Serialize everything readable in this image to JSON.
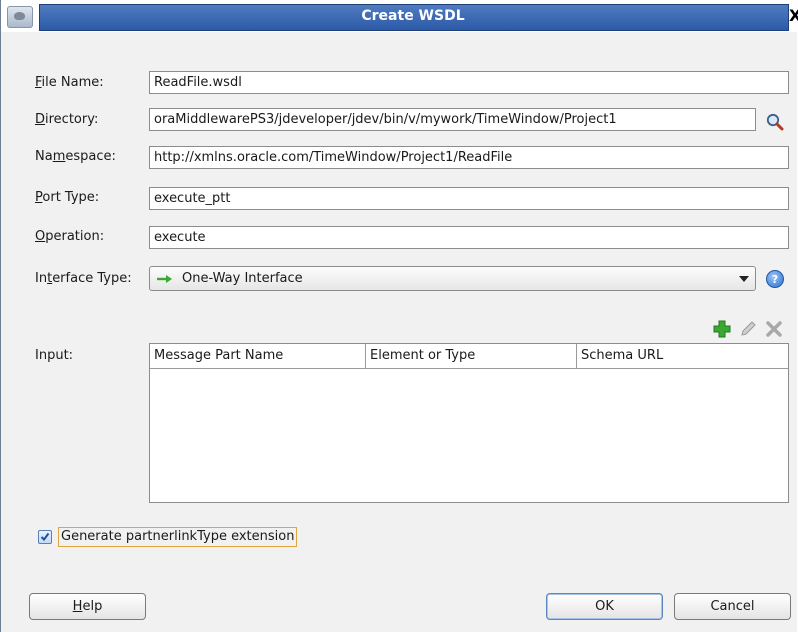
{
  "window": {
    "title": "Create WSDL",
    "close_glyph": "X"
  },
  "form": {
    "file_name": {
      "label_pre": "",
      "label_ul": "F",
      "label_post": "ile Name:",
      "value": "ReadFile.wsdl"
    },
    "directory": {
      "label_pre": "",
      "label_ul": "D",
      "label_post": "irectory:",
      "value": "oraMiddlewarePS3/jdeveloper/jdev/bin/v/mywork/TimeWindow/Project1"
    },
    "namespace": {
      "label_pre": "Na",
      "label_ul": "m",
      "label_post": "espace:",
      "value": "http://xmlns.oracle.com/TimeWindow/Project1/ReadFile"
    },
    "port_type": {
      "label_pre": "",
      "label_ul": "P",
      "label_post": "ort Type:",
      "value": "execute_ptt"
    },
    "operation": {
      "label_pre": "",
      "label_ul": "O",
      "label_post": "peration:",
      "value": "execute"
    },
    "interface_type": {
      "label_pre": "In",
      "label_ul": "t",
      "label_post": "erface Type:",
      "value": "One-Way Interface"
    }
  },
  "input": {
    "label": "Input:",
    "columns": [
      "Message Part Name",
      "Element or Type",
      "Schema URL"
    ],
    "rows": []
  },
  "toolbar_icons": [
    "add-icon",
    "edit-icon",
    "delete-icon"
  ],
  "checkbox": {
    "label": "Generate partnerlinkType extension",
    "checked": true
  },
  "buttons": {
    "help": {
      "ul": "H",
      "rest": "elp"
    },
    "ok": "OK",
    "cancel": "Cancel"
  },
  "colors": {
    "titlebar": "#3a67b3",
    "arrow_green": "#3aa832",
    "focus_outline": "#e0a540"
  }
}
